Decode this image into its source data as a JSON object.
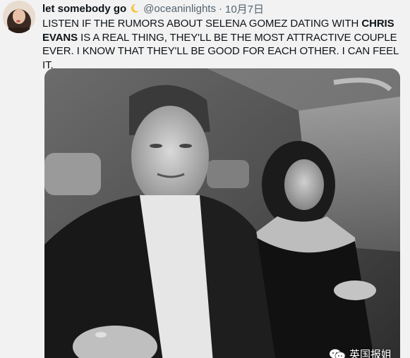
{
  "author": {
    "display_name": "let somebody go",
    "emoji_icon": "crescent-moon-icon",
    "handle": "@oceaninlights",
    "separator": "·",
    "date": "10月7日"
  },
  "tweet": {
    "text_part1": "LISTEN IF THE RUMORS ABOUT SELENA GOMEZ DATING WITH ",
    "text_bold": "CHRIS EVANS",
    "text_part2": " IS A REAL THING, THEY'LL BE THE MOST ATTRACTIVE COUPLE EVER. I KNOW THAT THEY'LL BE GOOD FOR EACH OTHER. I CAN FEEL IT."
  },
  "watermark": {
    "text": "英国报姐",
    "icon": "wechat-logo-icon"
  },
  "colors": {
    "name_text": "#0f1419",
    "secondary_text": "#536471",
    "background": "#f2f2f2"
  }
}
